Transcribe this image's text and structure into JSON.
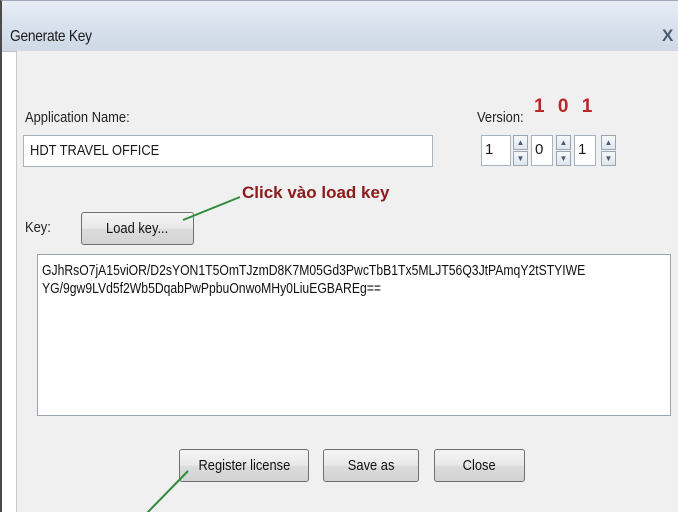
{
  "window": {
    "title": "Generate Key",
    "close_glyph": "X"
  },
  "app_name": {
    "label": "Application Name:",
    "value": "HDT TRAVEL OFFICE"
  },
  "version": {
    "label": "Version:",
    "annotation": "1 0 1",
    "major": "1",
    "minor": "0",
    "build": "1"
  },
  "key": {
    "label": "Key:",
    "load_button": "Load key...",
    "value": "GJhRsO7jA15viOR/D2sYON1T5OmTJzmD8K7M05Gd3PwcTbB1Tx5MLJT56Q3JtPAmqY2tSTYIWE\nYG/9gw9LVd5f2Wb5DqabPwPpbuOnwoMHy0LiuEGBAREg=="
  },
  "annotation": {
    "text": "Click vào load key",
    "color": "#8b1a1a"
  },
  "buttons": {
    "register": "Register license",
    "save_as": "Save as",
    "close": "Close"
  },
  "colors": {
    "arrow": "#2e8b3a",
    "annotation": "#8b1a1a",
    "version_annotation": "#b22a2a"
  }
}
